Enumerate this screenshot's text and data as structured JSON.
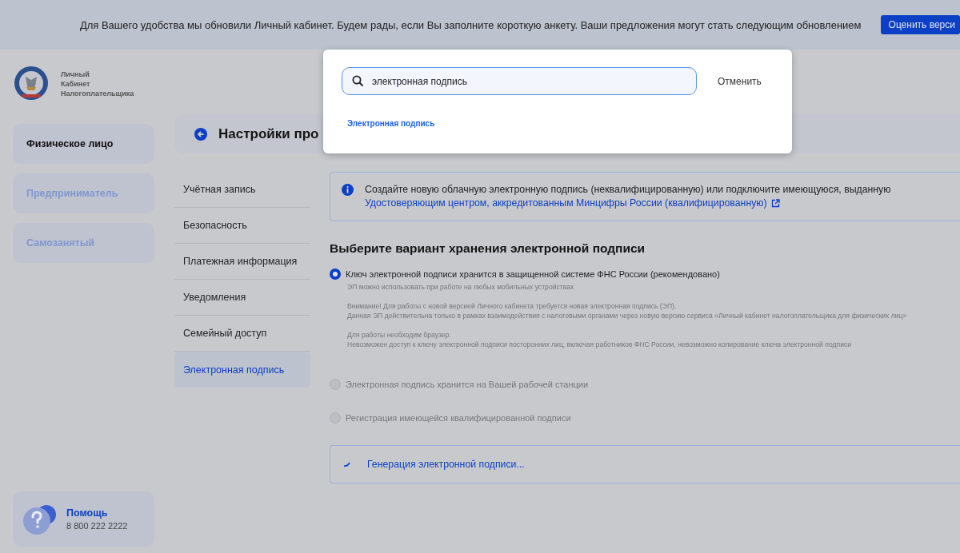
{
  "banner": {
    "text": "Для Вашего удобства мы обновили Личный кабинет. Будем рады, если Вы заполните короткую анкету. Ваши предложения могут стать следующим обновлением",
    "button": "Оценить верси"
  },
  "logo": {
    "lines": [
      "Личный",
      "Кабинет",
      "Налогоплательщика"
    ]
  },
  "profiles": [
    {
      "label": "Физическое лицо",
      "selected": true
    },
    {
      "label": "Предприниматель",
      "selected": false
    },
    {
      "label": "Самозанятый",
      "selected": false
    }
  ],
  "help": {
    "title": "Помощь",
    "phone": "8 800 222 2222"
  },
  "page_title": "Настройки про",
  "settings_menu": [
    {
      "label": "Учётная запись",
      "selected": false
    },
    {
      "label": "Безопасность",
      "selected": false
    },
    {
      "label": "Платежная информация",
      "selected": false
    },
    {
      "label": "Уведомления",
      "selected": false
    },
    {
      "label": "Семейный доступ",
      "selected": false
    },
    {
      "label": "Электронная подпись",
      "selected": true
    }
  ],
  "info": {
    "text": "Создайте новую облачную электронную подпись (неквалифицированную) или подключите имеющуюся, выданную",
    "link": "Удостоверяющим центром, аккредитованным Минцифры России (квалифицированную)"
  },
  "heading": "Выберите вариант хранения электронной подписи",
  "options": [
    {
      "label": "Ключ электронной подписи хранится в защищенной системе ФНС России (рекомендовано)",
      "selected": true,
      "disabled": false,
      "notes": [
        [
          "ЭП можно использовать при работе на любых мобильных устройствах"
        ],
        [
          "Внимание! Для работы с новой версией Личного кабинета требуется новая электронная подпись (ЭП).",
          "Данная ЭП действительна только в рамках взаимодействия с налоговыми органами через новую версию сервиса «Личный кабинет налогоплательщика для физических лиц»"
        ],
        [
          "Для работы необходим браузер.",
          "Невозможен доступ к ключу электронной подписи посторонних лиц, включая работников ФНС России, невозможно копирование ключа электронной подписи"
        ]
      ]
    },
    {
      "label": "Электронная подпись хранится на Вашей рабочей станции",
      "selected": false,
      "disabled": true
    },
    {
      "label": "Регистрация имеющейся квалифицированной подписи",
      "selected": false,
      "disabled": true
    }
  ],
  "progress": {
    "text": "Генерация электронной подписи..."
  },
  "search_modal": {
    "value": "электронная подпись",
    "cancel": "Отменить",
    "results": [
      "Электронная подпись"
    ]
  }
}
